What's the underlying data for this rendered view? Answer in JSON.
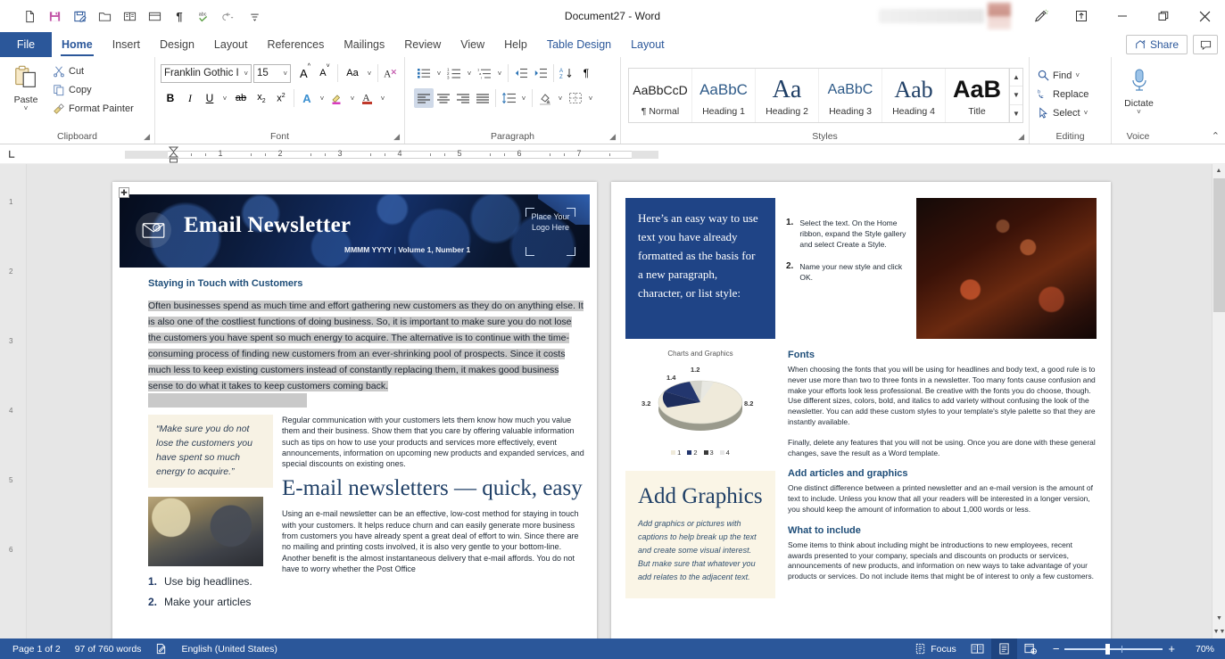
{
  "window": {
    "title": "Document27  -  Word",
    "quick_access": [
      "new-document-icon",
      "save-icon",
      "save-as-icon",
      "open-folder-icon",
      "read-mode-icon",
      "print-layout-icon",
      "show-formatting-icon",
      "spelling-check-icon",
      "undo-icon",
      "customize-qat-icon"
    ],
    "controls": [
      "pen-icon",
      "ribbon-display-options-icon",
      "minimize-icon",
      "restore-icon",
      "close-icon"
    ]
  },
  "tabs": [
    {
      "label": "File",
      "type": "file"
    },
    {
      "label": "Home",
      "active": true
    },
    {
      "label": "Insert"
    },
    {
      "label": "Design"
    },
    {
      "label": "Layout"
    },
    {
      "label": "References"
    },
    {
      "label": "Mailings"
    },
    {
      "label": "Review"
    },
    {
      "label": "View"
    },
    {
      "label": "Help"
    },
    {
      "label": "Table Design",
      "accent": true
    },
    {
      "label": "Layout",
      "accent": true
    }
  ],
  "tabstrip_right": {
    "share_label": "Share",
    "comment_icon": "comment-icon"
  },
  "ribbon": {
    "clipboard": {
      "label": "Clipboard",
      "paste_label": "Paste",
      "cut_label": "Cut",
      "copy_label": "Copy",
      "format_painter_label": "Format Painter"
    },
    "font": {
      "label": "Font",
      "font_name": "Franklin Gothic I",
      "font_size": "15",
      "grow_font": "A",
      "shrink_font": "A",
      "change_case": "Aa",
      "clear_formatting": "clear-formatting-icon",
      "bold": "B",
      "italic": "I",
      "underline": "U",
      "strikethrough": "ab",
      "subscript": "x",
      "superscript": "x",
      "text_effects": "A",
      "highlight": "A",
      "font_color": "A"
    },
    "paragraph": {
      "label": "Paragraph",
      "buttons": [
        "bullets-icon",
        "numbering-icon",
        "multilevel-list-icon",
        "decrease-indent-icon",
        "increase-indent-icon",
        "sort-icon",
        "show-marks-icon",
        "align-left-icon",
        "align-center-icon",
        "align-right-icon",
        "justify-icon",
        "line-spacing-icon",
        "shading-icon",
        "borders-icon"
      ],
      "selected": "align-left-icon"
    },
    "styles": {
      "label": "Styles",
      "items": [
        {
          "preview": "AaBbCcD",
          "name": "¶ Normal"
        },
        {
          "preview": "AaBbC",
          "name": "Heading 1"
        },
        {
          "preview": "Aa",
          "name": "Heading 2"
        },
        {
          "preview": "AaBbC",
          "name": "Heading 3"
        },
        {
          "preview": "Aab",
          "name": "Heading 4"
        },
        {
          "preview": "AaB",
          "name": "Title"
        }
      ]
    },
    "editing": {
      "label": "Editing",
      "find_label": "Find",
      "replace_label": "Replace",
      "select_label": "Select"
    },
    "voice": {
      "label": "Voice",
      "dictate_label": "Dictate"
    }
  },
  "ruler": {
    "numbers": [
      "1",
      "2",
      "3",
      "4",
      "5",
      "6",
      "7"
    ],
    "tab_stop": "L"
  },
  "document": {
    "page1": {
      "masthead": {
        "title": "Email Newsletter",
        "subtitle_date": "MMMM YYYY",
        "subtitle_sep": "|",
        "subtitle_volume": "Volume 1, Number 1",
        "logo_placeholder": "Place Your Logo Here",
        "icon": "email-envelope-icon"
      },
      "heading": "Staying in Touch with Customers",
      "selected_paragraph": "Often businesses spend as much time and effort gathering new customers as they do on anything else. It is also one of the costliest functions of doing business. So, it is important to make sure you do not lose the customers you have spent so much energy to acquire. The alternative is to continue with the time-consuming process of finding new customers from an ever-shrinking pool of prospects. Since it costs much less to keep existing customers instead of constantly replacing them, it makes good business sense to do what it takes to keep customers coming back.",
      "pull_quote": "“Make sure you do not lose the customers you have spent so much energy to acquire.”",
      "paragraph2": "Regular communication with your customers lets them know how much you value them and their business. Show them that you care by offering valuable information such as tips on how to use your products and services more effectively, event announcements, information on upcoming new products and expanded services, and special discounts on existing ones.",
      "big_heading": "E-mail newsletters — quick, easy",
      "paragraph3": "Using an e-mail newsletter can be an effective, low-cost method for staying in touch with your customers. It helps reduce churn and can easily generate more business from customers you have already spent a great deal of effort to win. Since there are no mailing and printing costs involved, it is also very gentle to your bottom-line. Another benefit is the almost instantaneous delivery that e-mail affords. You do not have to worry whether the Post Office",
      "tips": [
        {
          "num": "1.",
          "text": "Use big headlines."
        },
        {
          "num": "2.",
          "text": "Make your articles"
        }
      ]
    },
    "page2": {
      "callout": "Here’s an easy way to use text you have already formatted as the basis for a new paragraph, character, or list style:",
      "steps": [
        {
          "num": "1.",
          "text": "Select the text. On the Home ribbon, expand the Style gallery and select Create a Style."
        },
        {
          "num": "2.",
          "text": "Name your new style and click OK."
        }
      ],
      "add_graphics": {
        "heading": "Add Graphics",
        "body": "Add graphics or pictures with captions to help break up the text and create some visual interest. But make sure that whatever you add relates to the adjacent text."
      },
      "sections": [
        {
          "heading": "Fonts",
          "paragraphs": [
            "When choosing the fonts that you will be using for headlines and body text, a good rule is to never use more than two to three fonts in a newsletter. Too many fonts cause confusion and make your efforts look less professional. Be creative with the fonts you do choose, though. Use different sizes, colors, bold, and italics to add variety without confusing the look of the newsletter. You can add these custom styles to your template's style palette so that they are instantly available.",
            "Finally, delete any features that you will not be using. Once you are done with these general changes, save the result as a Word template."
          ]
        },
        {
          "heading": "Add articles and graphics",
          "paragraphs": [
            "One distinct difference between a printed newsletter and an e-mail version is the amount of text to include. Unless you know that all your readers will be interested in a longer version, you should keep the amount of information to about 1,000 words or less."
          ]
        },
        {
          "heading": "What to include",
          "paragraphs": [
            "Some items to think about including might be introductions to new employees, recent awards presented to your company, specials and discounts on products or services, announcements of new products, and information on new ways to take advantage of your products or services. Do not include items that might be of interest to only a few customers."
          ]
        }
      ]
    }
  },
  "chart_data": {
    "type": "pie",
    "title": "Charts and Graphics",
    "categories": [
      "1",
      "2",
      "3",
      "4"
    ],
    "values": [
      8.2,
      3.2,
      1.4,
      1.2
    ],
    "labels": [
      "8.2",
      "3.2",
      "1.4",
      "1.2"
    ],
    "legend": [
      "1",
      "2",
      "3",
      "4"
    ],
    "legend_position": "bottom",
    "colors": [
      "#efeada",
      "#23366e",
      "#c8c8be",
      "#e3e3e3"
    ],
    "xlabel": "",
    "ylabel": ""
  },
  "statusbar": {
    "page": "Page 1 of 2",
    "words": "97 of 760 words",
    "proofing_icon": "proofing-errors-icon",
    "language": "English (United States)",
    "focus_label": "Focus",
    "views": [
      "read-mode-icon",
      "print-layout-icon",
      "web-layout-icon"
    ],
    "zoom_out": "−",
    "zoom_in": "+",
    "zoom_level": "70%"
  }
}
